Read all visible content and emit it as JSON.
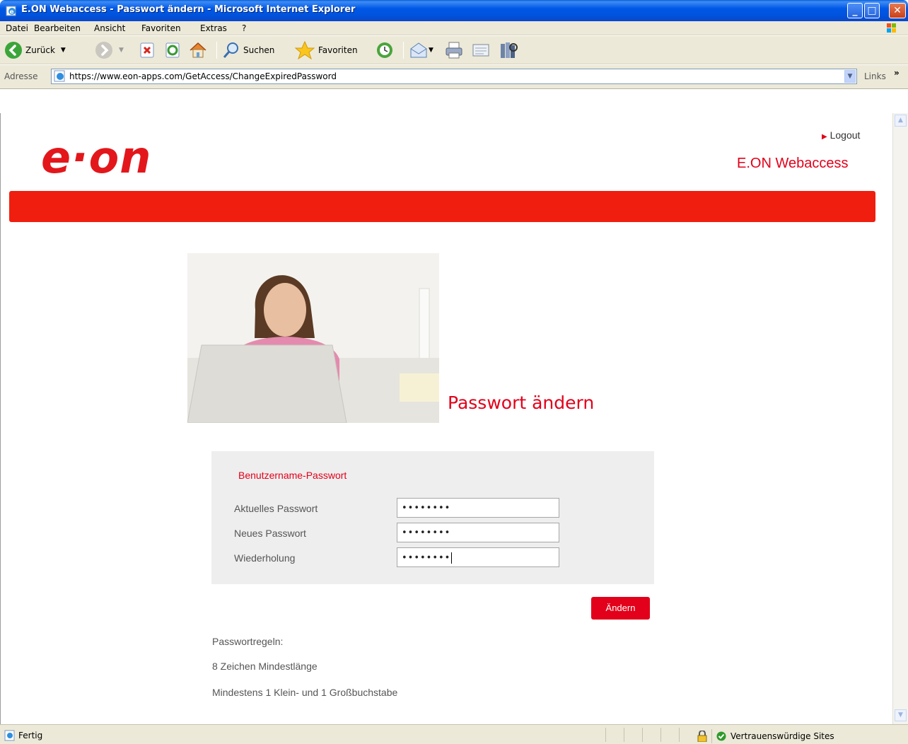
{
  "window": {
    "title": "E.ON Webaccess - Passwort ändern - Microsoft Internet Explorer"
  },
  "menubar": {
    "items": [
      "Datei",
      "Bearbeiten",
      "Ansicht",
      "Favoriten",
      "Extras",
      "?"
    ]
  },
  "toolbar": {
    "back_label": "Zurück",
    "search_label": "Suchen",
    "favorites_label": "Favoriten"
  },
  "address": {
    "label": "Adresse",
    "url": "https://www.eon-apps.com/GetAccess/ChangeExpiredPassword",
    "links_label": "Links"
  },
  "header": {
    "logo_text": "e·on",
    "logout_label": "Logout",
    "app_name": "E.ON Webaccess"
  },
  "page": {
    "title": "Passwort ändern",
    "section_title": "Benutzername-Passwort",
    "fields": [
      {
        "label": "Aktuelles Passwort",
        "value": "••••••••"
      },
      {
        "label": "Neues Passwort",
        "value": "••••••••"
      },
      {
        "label": "Wiederholung",
        "value": "••••••••"
      }
    ],
    "submit_label": "Ändern",
    "rules_title": "Passwortregeln:",
    "rules": [
      "8 Zeichen Mindestlänge",
      "Mindestens 1 Klein- und 1 Großbuchstabe"
    ]
  },
  "statusbar": {
    "status": "Fertig",
    "zone": "Vertrauenswürdige Sites"
  },
  "colors": {
    "brand_red": "#e2001a",
    "bar_red": "#f01e0e",
    "xp_blue": "#0058e6"
  }
}
